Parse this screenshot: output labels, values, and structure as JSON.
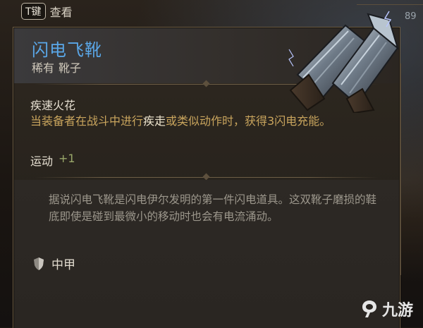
{
  "hint": {
    "key": "T键",
    "label": "查看"
  },
  "corner_number": "89",
  "item": {
    "name": "闪电飞靴",
    "rarity": "稀有",
    "type": "靴子",
    "passive": {
      "name": "疾速火花",
      "desc_part1": "当装备者在战斗中进行",
      "desc_highlight": "疾走",
      "desc_part2": "或类似动作时，获得3闪电充能。"
    },
    "stat": {
      "label": "运动",
      "value": "+1"
    },
    "lore": "据说闪电飞靴是闪电伊尔发明的第一件闪电道具。这双靴子磨损的鞋底即使是碰到最微小的移动时也会有电流涌动。",
    "armor_type": "中甲"
  },
  "watermark": {
    "text": "九游"
  },
  "colors": {
    "title": "#5aa7e8",
    "effect_text": "#c9a55d",
    "stat_value": "#9aa86a",
    "lore_text": "#9c978c"
  },
  "icons": {
    "armor": "shield-icon",
    "item_image": "gauntlet-boots-image",
    "watermark_logo": "nine-game-logo"
  }
}
